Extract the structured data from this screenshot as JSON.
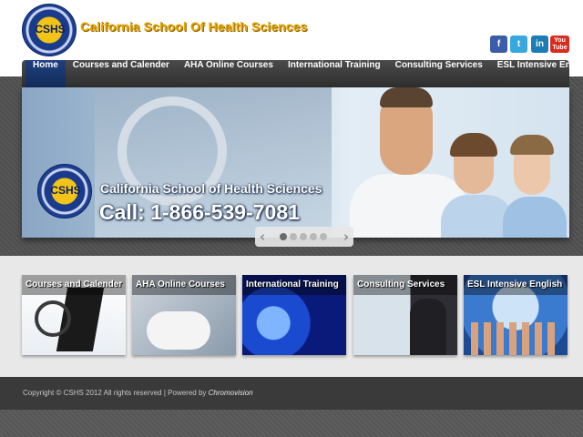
{
  "header": {
    "logo_text": "CSHS",
    "brand_name": "California School Of Health Sciences",
    "social": [
      {
        "icon": "facebook-icon",
        "label": "f",
        "color": "#3b5ca8"
      },
      {
        "icon": "twitter-icon",
        "label": "t",
        "color": "#38a8dd"
      },
      {
        "icon": "linkedin-icon",
        "label": "in",
        "color": "#1c7cb8"
      },
      {
        "icon": "youtube-icon",
        "label": "You Tube",
        "color": "#d92b1e"
      }
    ]
  },
  "nav": {
    "items": [
      {
        "label": "Home",
        "active": true
      },
      {
        "label": "Courses and Calender",
        "active": false
      },
      {
        "label": "AHA Online Courses",
        "active": false
      },
      {
        "label": "International Training",
        "active": false
      },
      {
        "label": "Consulting Services",
        "active": false
      },
      {
        "label": "ESL Intensive English",
        "active": false
      }
    ]
  },
  "hero": {
    "logo_text": "CSHS",
    "title": "California School of Health Sciences",
    "phone": "Call: 1-866-539-7081",
    "slider": {
      "prev": "‹",
      "next": "›",
      "slides": 5,
      "active_index": 0
    }
  },
  "features": [
    {
      "label": "Courses and Calender"
    },
    {
      "label": "AHA Online Courses"
    },
    {
      "label": "International Training"
    },
    {
      "label": "Consulting Services"
    },
    {
      "label": "ESL Intensive English"
    }
  ],
  "footer": {
    "copyright": "Copyright © CSHS 2012 All rights reserved | Powered by",
    "powered_by": "Chromovision"
  },
  "colors": {
    "nav_active": "#1e3f7e",
    "brand_gold": "#e6a800",
    "footer_bg": "#3a3a3a"
  }
}
